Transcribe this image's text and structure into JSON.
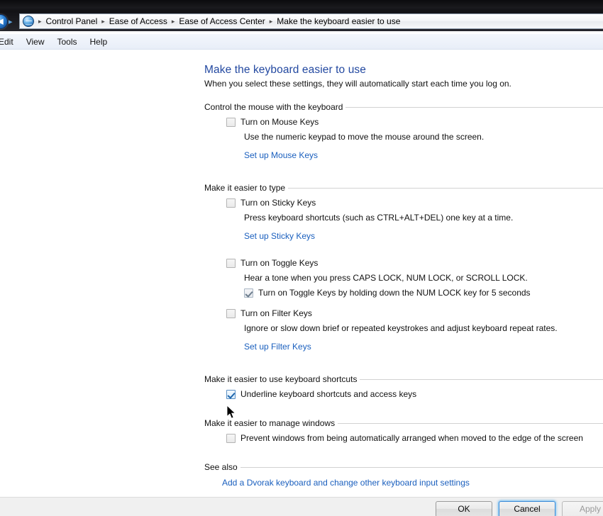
{
  "window": {
    "addressbar": {
      "icon": "control-panel-globe-icon",
      "back_icon": "back-arrow-icon",
      "forward_icon": "forward-chevron-icon",
      "separator": "▸",
      "breadcrumbs": [
        "Control Panel",
        "Ease of Access",
        "Ease of Access Center",
        "Make the keyboard easier to use"
      ]
    },
    "menubar": [
      "Edit",
      "View",
      "Tools",
      "Help"
    ]
  },
  "page": {
    "title": "Make the keyboard easier to use",
    "subtitle": "When you select these settings, they will automatically start each time you log on.",
    "title_color": "#2248a0",
    "link_color": "#1a5fbe"
  },
  "sections": {
    "mouse": {
      "heading": "Control the mouse with the keyboard",
      "checkbox_label": "Turn on Mouse Keys",
      "checkbox_checked": false,
      "description": "Use the numeric keypad to move the mouse around the screen.",
      "link": "Set up Mouse Keys"
    },
    "type": {
      "heading": "Make it easier to type",
      "sticky": {
        "checkbox_label": "Turn on Sticky Keys",
        "checkbox_checked": false,
        "description": "Press keyboard shortcuts (such as CTRL+ALT+DEL) one key at a time.",
        "link": "Set up Sticky Keys"
      },
      "toggle": {
        "checkbox_label": "Turn on Toggle Keys",
        "checkbox_checked": false,
        "description": "Hear a tone when you press CAPS LOCK, NUM LOCK, or SCROLL LOCK.",
        "sub_checkbox_label": "Turn on Toggle Keys by holding down the NUM LOCK key for 5 seconds",
        "sub_checkbox_checked": true
      },
      "filter": {
        "checkbox_label": "Turn on Filter Keys",
        "checkbox_checked": false,
        "description": "Ignore or slow down brief or repeated keystrokes and adjust keyboard repeat rates.",
        "link": "Set up Filter Keys"
      }
    },
    "shortcuts": {
      "heading": "Make it easier to use keyboard shortcuts",
      "checkbox_label": "Underline keyboard shortcuts and access keys",
      "checkbox_checked": true
    },
    "windows": {
      "heading": "Make it easier to manage windows",
      "checkbox_label": "Prevent windows from being automatically arranged when moved to the edge of the screen",
      "checkbox_checked": false
    },
    "see_also": {
      "heading": "See also",
      "link": "Add a Dvorak keyboard and change other keyboard input settings"
    }
  },
  "footer": {
    "ok": "OK",
    "cancel": "Cancel",
    "apply": "Apply"
  }
}
